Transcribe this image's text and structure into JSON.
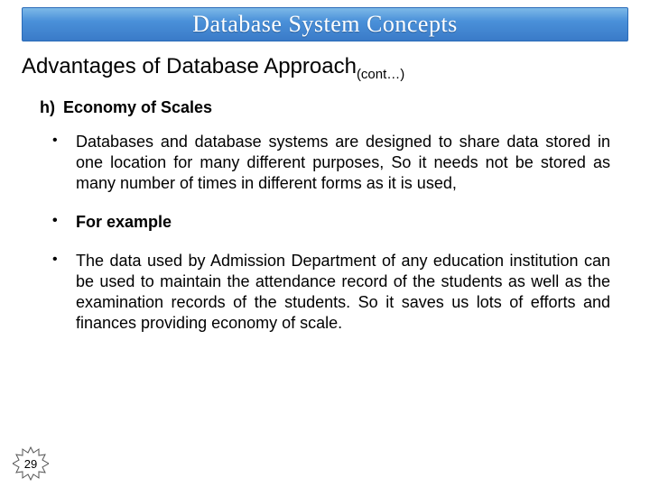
{
  "header": {
    "title": "Database System Concepts"
  },
  "subtitle": {
    "text": "Advantages of Database Approach",
    "cont": "(cont…)"
  },
  "section": {
    "marker": "h)",
    "heading": "Economy of Scales"
  },
  "bullets": [
    {
      "text": "Databases and database systems are designed to share data stored in one location for many different purposes, So it needs not be stored as many number of times in different forms as it is used,",
      "bold": false
    },
    {
      "text": "For example",
      "bold": true
    },
    {
      "text": "The data used by Admission Department of any education institution can be used to maintain the attendance record of the students as well as the examination records of the students. So it saves us lots of efforts and finances providing economy of scale.",
      "bold": false
    }
  ],
  "page_number": "29"
}
